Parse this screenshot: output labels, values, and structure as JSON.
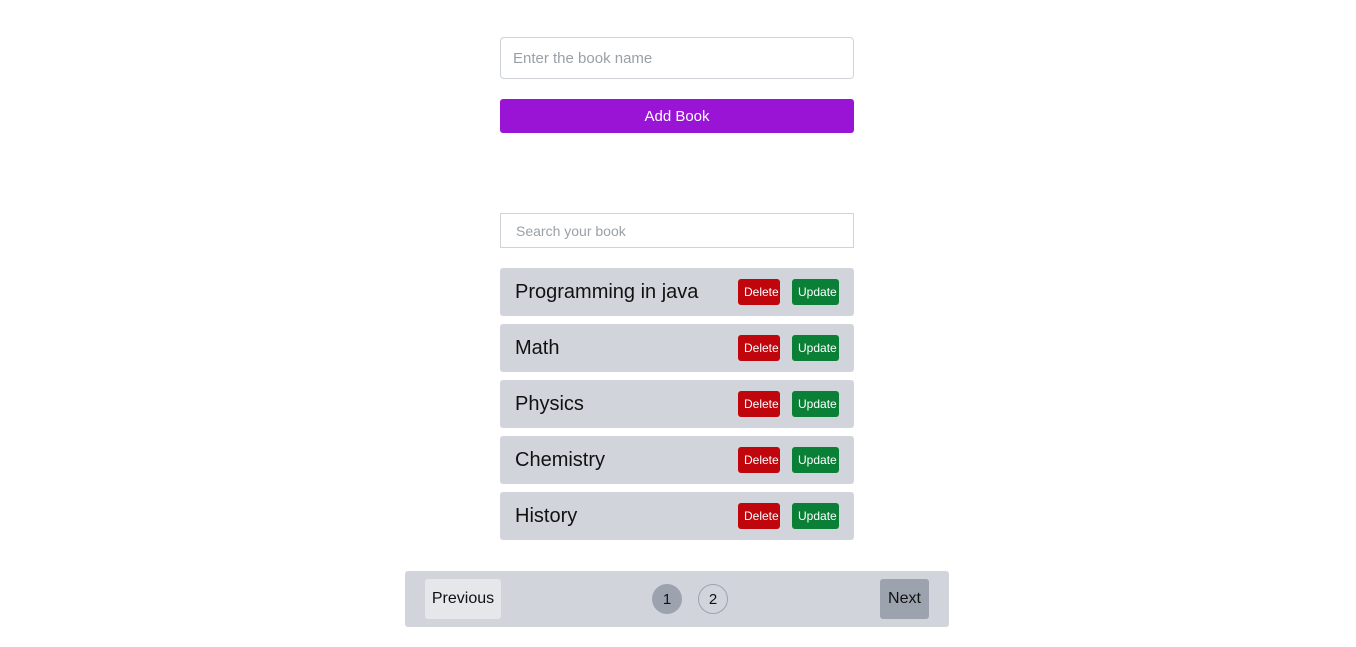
{
  "add_form": {
    "book_name_placeholder": "Enter the book name",
    "book_name_value": "",
    "add_button_label": "Add Book"
  },
  "search": {
    "placeholder": "Search your book",
    "value": ""
  },
  "books": [
    {
      "name": "Programming in java",
      "delete_label": "Delete",
      "update_label": "Update"
    },
    {
      "name": "Math",
      "delete_label": "Delete",
      "update_label": "Update"
    },
    {
      "name": "Physics",
      "delete_label": "Delete",
      "update_label": "Update"
    },
    {
      "name": "Chemistry",
      "delete_label": "Delete",
      "update_label": "Update"
    },
    {
      "name": "History",
      "delete_label": "Delete",
      "update_label": "Update"
    }
  ],
  "pagination": {
    "previous_label": "Previous",
    "next_label": "Next",
    "pages": [
      "1",
      "2"
    ],
    "current_page": "1"
  },
  "colors": {
    "accent": "#9a14d6",
    "delete": "#c0060d",
    "update": "#0a8037",
    "item_bg": "#d1d5db"
  }
}
